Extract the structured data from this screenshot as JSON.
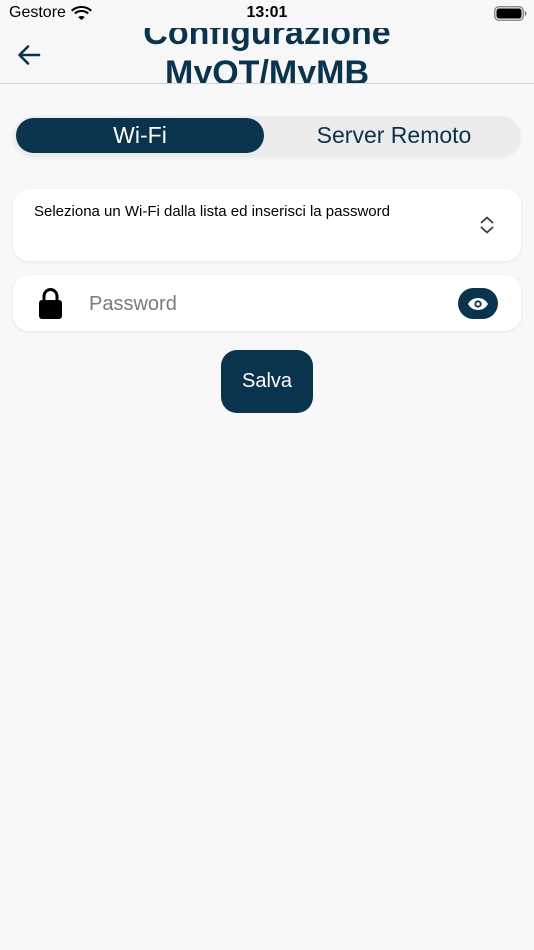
{
  "status_bar": {
    "carrier": "Gestore",
    "time": "13:01"
  },
  "nav": {
    "title": "Configurazione MyOT/MyMB"
  },
  "tabs": [
    {
      "label": "Wi-Fi",
      "selected": true
    },
    {
      "label": "Server Remoto",
      "selected": false
    }
  ],
  "wifi_select": {
    "text": "Seleziona un Wi-Fi dalla lista ed inserisci la password"
  },
  "password": {
    "placeholder": "Password",
    "value": ""
  },
  "save_label": "Salva",
  "colors": {
    "primary": "#0a334d",
    "background": "#f8f8fb",
    "card": "#ffffff"
  },
  "icons": {
    "back": "arrow-left-icon",
    "wifi": "wifi-icon",
    "battery": "battery-icon",
    "select": "chevron-up-down-icon",
    "lock": "lock-icon",
    "reveal": "eye-icon"
  }
}
